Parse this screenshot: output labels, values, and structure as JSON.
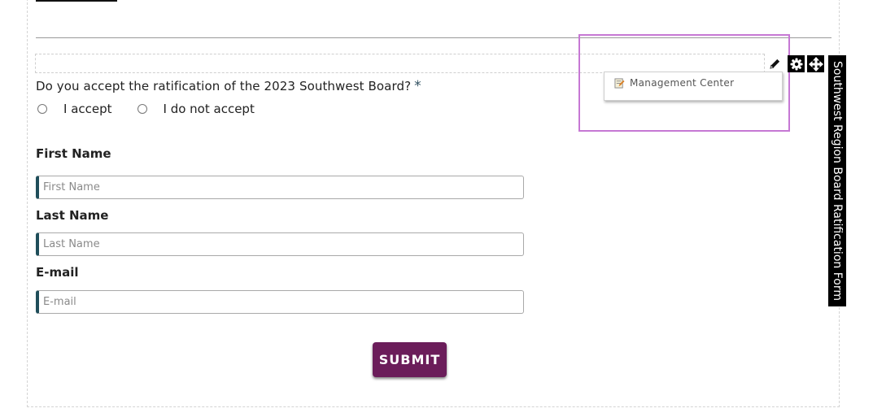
{
  "question": {
    "text": "Do you accept the ratification of the 2023 Southwest Board?",
    "required_mark": "*"
  },
  "radio_options": [
    {
      "label": "I accept",
      "checked": false
    },
    {
      "label": "I do not accept",
      "checked": false
    }
  ],
  "fields": {
    "first_name": {
      "label": "First Name",
      "placeholder": "First Name",
      "value": ""
    },
    "last_name": {
      "label": "Last Name",
      "placeholder": "Last Name",
      "value": ""
    },
    "email": {
      "label": "E-mail",
      "placeholder": "E-mail",
      "value": ""
    }
  },
  "submit_label": "SUBMIT",
  "context_menu": {
    "items": [
      {
        "label": "Management Center",
        "icon": "edit-note-icon"
      }
    ]
  },
  "toolbar": {
    "icons": [
      "pencil-icon",
      "gear-icon",
      "move-icon"
    ]
  },
  "side_tab": {
    "title": "Southwest Region Board Ratification Form"
  },
  "colors": {
    "accent_submit": "#6b1d5a",
    "input_accent": "#1f4e5a",
    "selection_outline": "#c678d4"
  }
}
